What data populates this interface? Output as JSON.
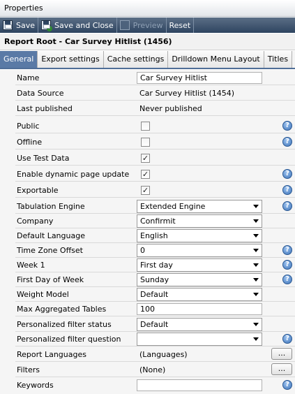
{
  "window": {
    "title": "Properties"
  },
  "toolbar": {
    "save_label": "Save",
    "save_close_label": "Save and Close",
    "preview_label": "Preview",
    "reset_label": "Reset"
  },
  "report": {
    "title": "Report Root - Car Survey Hitlist (1456)"
  },
  "tabs": [
    {
      "label": "General",
      "active": true
    },
    {
      "label": "Export settings"
    },
    {
      "label": "Cache settings"
    },
    {
      "label": "Drilldown Menu Layout"
    },
    {
      "label": "Titles"
    }
  ],
  "form": {
    "name": {
      "label": "Name",
      "value": "Car Survey Hitlist"
    },
    "data_source": {
      "label": "Data Source",
      "value": "Car Survey Hitlist (1454)"
    },
    "last_published": {
      "label": "Last published",
      "value": "Never published"
    },
    "public": {
      "label": "Public",
      "checked": false
    },
    "offline": {
      "label": "Offline",
      "checked": false
    },
    "use_test_data": {
      "label": "Use Test Data",
      "checked": true,
      "mark": "✓"
    },
    "enable_dynamic": {
      "label": "Enable dynamic page update",
      "checked": true,
      "mark": "✓"
    },
    "exportable": {
      "label": "Exportable",
      "checked": true,
      "mark": "✓"
    },
    "tabulation_engine": {
      "label": "Tabulation Engine",
      "value": "Extended Engine"
    },
    "company": {
      "label": "Company",
      "value": "Confirmit"
    },
    "default_language": {
      "label": "Default Language",
      "value": "English"
    },
    "time_zone_offset": {
      "label": "Time Zone Offset",
      "value": "0"
    },
    "week1": {
      "label": "Week 1",
      "value": "First day"
    },
    "first_day_of_week": {
      "label": "First Day of Week",
      "value": "Sunday"
    },
    "weight_model": {
      "label": "Weight Model",
      "value": "Default"
    },
    "max_aggregated_tables": {
      "label": "Max Aggregated Tables",
      "value": "100"
    },
    "personalized_filter_status": {
      "label": "Personalized filter status",
      "value": "Default"
    },
    "personalized_filter_question": {
      "label": "Personalized filter question",
      "value": ""
    },
    "report_languages": {
      "label": "Report Languages",
      "value": "(Languages)",
      "button": "..."
    },
    "filters": {
      "label": "Filters",
      "value": "(None)",
      "button": "..."
    },
    "keywords": {
      "label": "Keywords",
      "value": ""
    }
  },
  "help_glyph": "?",
  "colors": {
    "toolbar_bg": "#3d5470",
    "active_tab": "#5a7aa6",
    "help_icon": "#3d73b8"
  }
}
